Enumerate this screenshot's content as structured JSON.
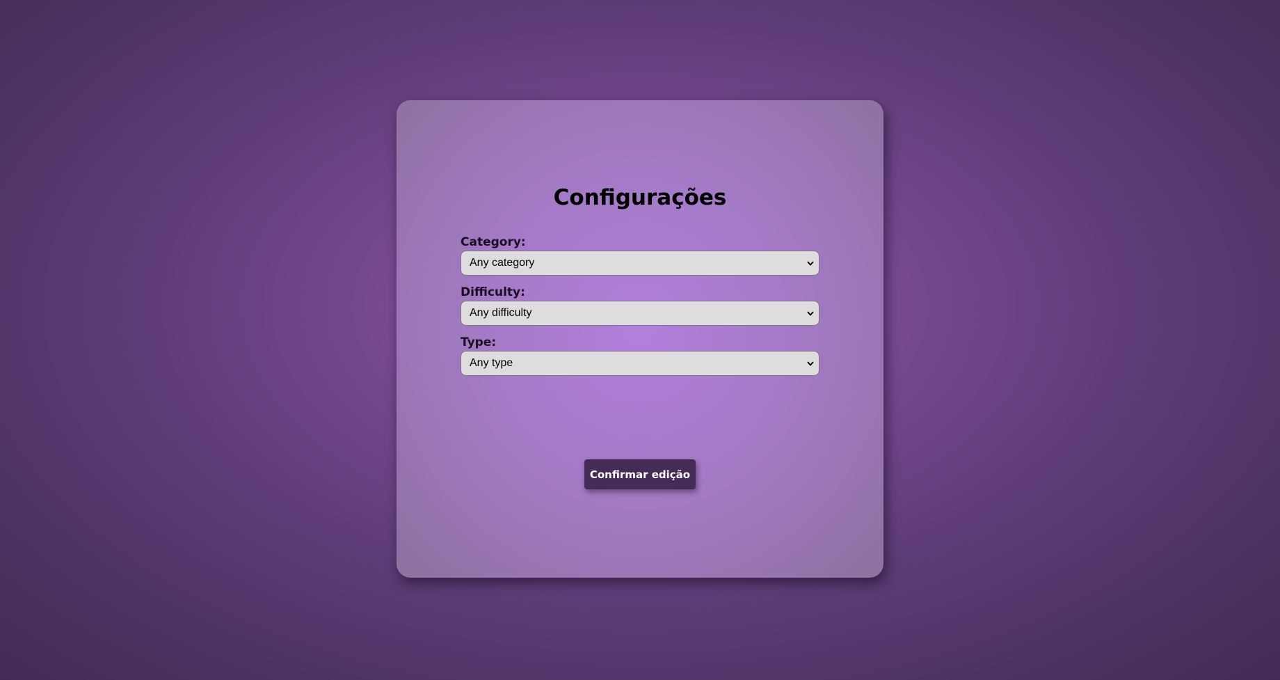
{
  "settings": {
    "title": "Configurações",
    "fields": [
      {
        "label": "Category:",
        "selected": "Any category"
      },
      {
        "label": "Difficulty:",
        "selected": "Any difficulty"
      },
      {
        "label": "Type:",
        "selected": "Any type"
      }
    ],
    "confirm_label": "Confirmar edição"
  },
  "colors": {
    "background": "#5a3a73",
    "card": "#a47ac6",
    "button": "#452c57",
    "select_bg": "#dedcdf"
  },
  "icons": {
    "select_arrow": "chevron-down-icon"
  }
}
